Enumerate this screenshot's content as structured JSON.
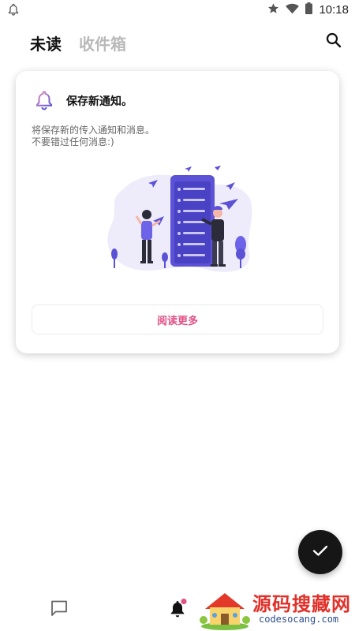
{
  "status_bar": {
    "time": "10:18",
    "icons": [
      "notification-bell-icon",
      "star-icon",
      "wifi-icon",
      "battery-icon"
    ]
  },
  "header": {
    "tabs": [
      {
        "label": "未读",
        "active": true
      },
      {
        "label": "收件箱",
        "active": false
      }
    ],
    "search_icon": "search-icon"
  },
  "card": {
    "title": "保存新通知。",
    "description_lines": [
      "将保存新的传入通知和消息。",
      "不要错过任何消息:)"
    ],
    "button_label": "阅读更多",
    "accent_color": "#e05287",
    "illustration_color": "#5b52d6"
  },
  "fab": {
    "icon": "check-icon"
  },
  "bottom_nav": {
    "items": [
      {
        "icon": "chat-icon"
      },
      {
        "icon": "bell-icon",
        "badge": true
      }
    ]
  },
  "watermark": {
    "title": "源码搜藏网",
    "url": "codesocang.com"
  }
}
